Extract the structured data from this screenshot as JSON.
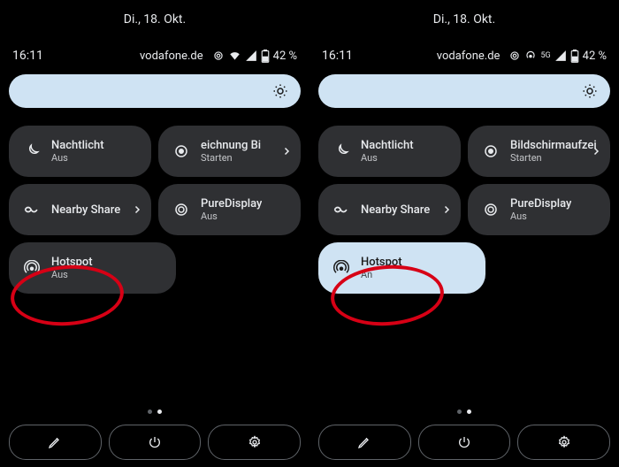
{
  "left": {
    "date": "Di., 18. Okt.",
    "clock": "16:11",
    "carrier": "vodafone.de",
    "network_extra": "",
    "battery": "42 %",
    "tiles": {
      "nightlight": {
        "title": "Nachtlicht",
        "sub": "Aus"
      },
      "screenrec": {
        "title": "eichnung   Bi",
        "sub": "Starten"
      },
      "nearby": {
        "title": "Nearby Share",
        "sub": ""
      },
      "puredisplay": {
        "title": "PureDisplay",
        "sub": "Aus"
      },
      "hotspot": {
        "title": "Hotspot",
        "sub": "Aus",
        "on": false
      }
    }
  },
  "right": {
    "date": "Di., 18. Okt.",
    "clock": "16:11",
    "carrier": "vodafone.de",
    "network_extra": "5G",
    "battery": "42 %",
    "tiles": {
      "nightlight": {
        "title": "Nachtlicht",
        "sub": "Aus"
      },
      "screenrec": {
        "title": "Bildschirmaufzei",
        "sub": "Starten"
      },
      "nearby": {
        "title": "Nearby Share",
        "sub": ""
      },
      "puredisplay": {
        "title": "PureDisplay",
        "sub": "Aus"
      },
      "hotspot": {
        "title": "Hotspot",
        "sub": "An",
        "on": true
      }
    }
  }
}
